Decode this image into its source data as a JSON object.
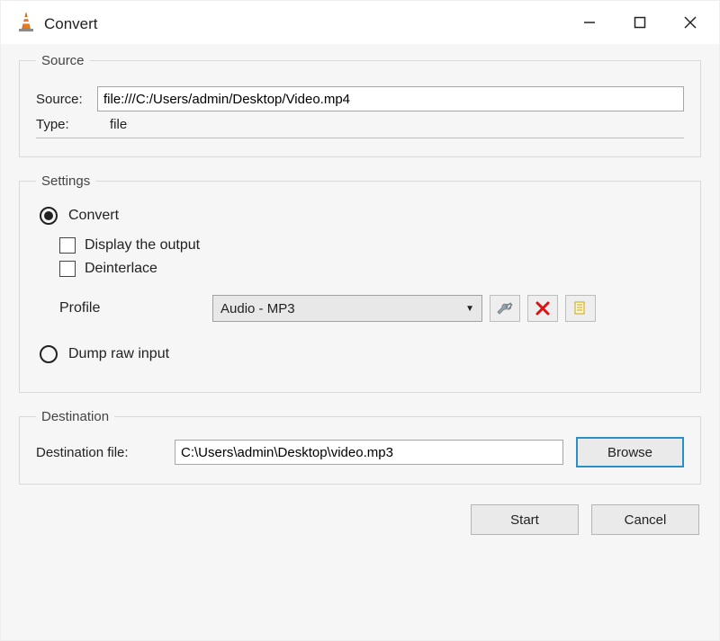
{
  "window": {
    "title": "Convert"
  },
  "source": {
    "legend": "Source",
    "source_label": "Source:",
    "source_value": "file:///C:/Users/admin/Desktop/Video.mp4",
    "type_label": "Type:",
    "type_value": "file"
  },
  "settings": {
    "legend": "Settings",
    "convert_label": "Convert",
    "display_output_label": "Display the output",
    "deinterlace_label": "Deinterlace",
    "profile_label": "Profile",
    "profile_value": "Audio - MP3",
    "dump_label": "Dump raw input"
  },
  "destination": {
    "legend": "Destination",
    "file_label": "Destination file:",
    "file_value": "C:\\Users\\admin\\Desktop\\video.mp3",
    "browse_label": "Browse"
  },
  "buttons": {
    "start": "Start",
    "cancel": "Cancel"
  }
}
